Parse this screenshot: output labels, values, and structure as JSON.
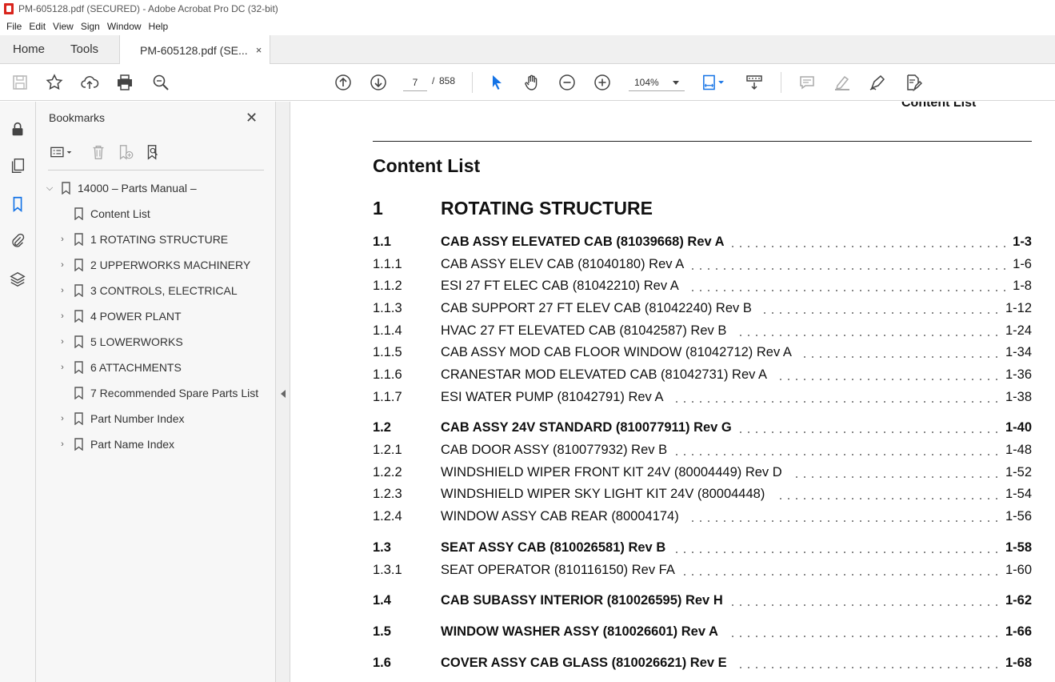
{
  "window": {
    "title": "PM-605128.pdf (SECURED) - Adobe Acrobat Pro DC (32-bit)"
  },
  "menu": [
    "File",
    "Edit",
    "View",
    "Sign",
    "Window",
    "Help"
  ],
  "tabs": {
    "home": "Home",
    "tools": "Tools",
    "document": "PM-605128.pdf (SE...",
    "close": "×"
  },
  "toolbar": {
    "current_page": "7",
    "separator": "/",
    "total_pages": "858",
    "zoom": "104%"
  },
  "bookmarks": {
    "title": "Bookmarks",
    "close": "✕",
    "items": [
      {
        "label": "14000 – Parts Manual –",
        "expander": "collapse"
      },
      {
        "label": "Content List",
        "expander": "none"
      },
      {
        "label": "1 ROTATING STRUCTURE",
        "expander": "expand"
      },
      {
        "label": "2 UPPERWORKS MACHINERY",
        "expander": "expand"
      },
      {
        "label": "3 CONTROLS, ELECTRICAL",
        "expander": "expand"
      },
      {
        "label": "4 POWER PLANT",
        "expander": "expand"
      },
      {
        "label": "5 LOWERWORKS",
        "expander": "expand"
      },
      {
        "label": "6 ATTACHMENTS",
        "expander": "expand"
      },
      {
        "label": "7 Recommended Spare Parts List",
        "expander": "none"
      },
      {
        "label": "Part Number Index",
        "expander": "expand"
      },
      {
        "label": "Part Name Index",
        "expander": "expand"
      }
    ]
  },
  "document": {
    "running_header": "Content List",
    "title": "Content List",
    "section": {
      "number": "1",
      "title": "ROTATING STRUCTURE"
    },
    "entries": [
      {
        "num": "1.1",
        "title": "CAB ASSY ELEVATED CAB (81039668) Rev A",
        "page": "1-3",
        "bold": true
      },
      {
        "num": "1.1.1",
        "title": "CAB ASSY ELEV CAB (81040180) Rev A",
        "page": "1-6",
        "bold": false
      },
      {
        "num": "1.1.2",
        "title": "ESI 27 FT ELEC CAB (81042210) Rev A",
        "page": "1-8",
        "bold": false
      },
      {
        "num": "1.1.3",
        "title": "CAB SUPPORT 27 FT ELEV CAB (81042240) Rev B",
        "page": "1-12",
        "bold": false
      },
      {
        "num": "1.1.4",
        "title": "HVAC 27 FT ELEVATED CAB (81042587) Rev B",
        "page": "1-24",
        "bold": false
      },
      {
        "num": "1.1.5",
        "title": "CAB ASSY MOD CAB FLOOR WINDOW (81042712) Rev A",
        "page": "1-34",
        "bold": false
      },
      {
        "num": "1.1.6",
        "title": "CRANESTAR MOD ELEVATED CAB (81042731) Rev A",
        "page": "1-36",
        "bold": false
      },
      {
        "num": "1.1.7",
        "title": "ESI WATER PUMP (81042791) Rev A",
        "page": "1-38",
        "bold": false
      },
      {
        "num": "1.2",
        "title": "CAB ASSY 24V STANDARD (810077911) Rev G",
        "page": "1-40",
        "bold": true
      },
      {
        "num": "1.2.1",
        "title": "CAB DOOR ASSY (810077932) Rev B",
        "page": "1-48",
        "bold": false
      },
      {
        "num": "1.2.2",
        "title": "WINDSHIELD WIPER FRONT KIT 24V (80004449) Rev D",
        "page": "1-52",
        "bold": false
      },
      {
        "num": "1.2.3",
        "title": "WINDSHIELD WIPER SKY LIGHT KIT 24V (80004448)",
        "page": "1-54",
        "bold": false
      },
      {
        "num": "1.2.4",
        "title": "WINDOW ASSY CAB REAR (80004174)",
        "page": "1-56",
        "bold": false
      },
      {
        "num": "1.3",
        "title": "SEAT ASSY CAB (810026581) Rev B",
        "page": "1-58",
        "bold": true
      },
      {
        "num": "1.3.1",
        "title": "SEAT OPERATOR (810116150) Rev FA",
        "page": "1-60",
        "bold": false
      },
      {
        "num": "1.4",
        "title": "CAB SUBASSY INTERIOR (810026595) Rev H",
        "page": "1-62",
        "bold": true
      },
      {
        "num": "1.5",
        "title": "WINDOW WASHER ASSY (810026601) Rev A",
        "page": "1-66",
        "bold": true
      },
      {
        "num": "1.6",
        "title": "COVER ASSY CAB GLASS (810026621) Rev E",
        "page": "1-68",
        "bold": true
      }
    ]
  }
}
